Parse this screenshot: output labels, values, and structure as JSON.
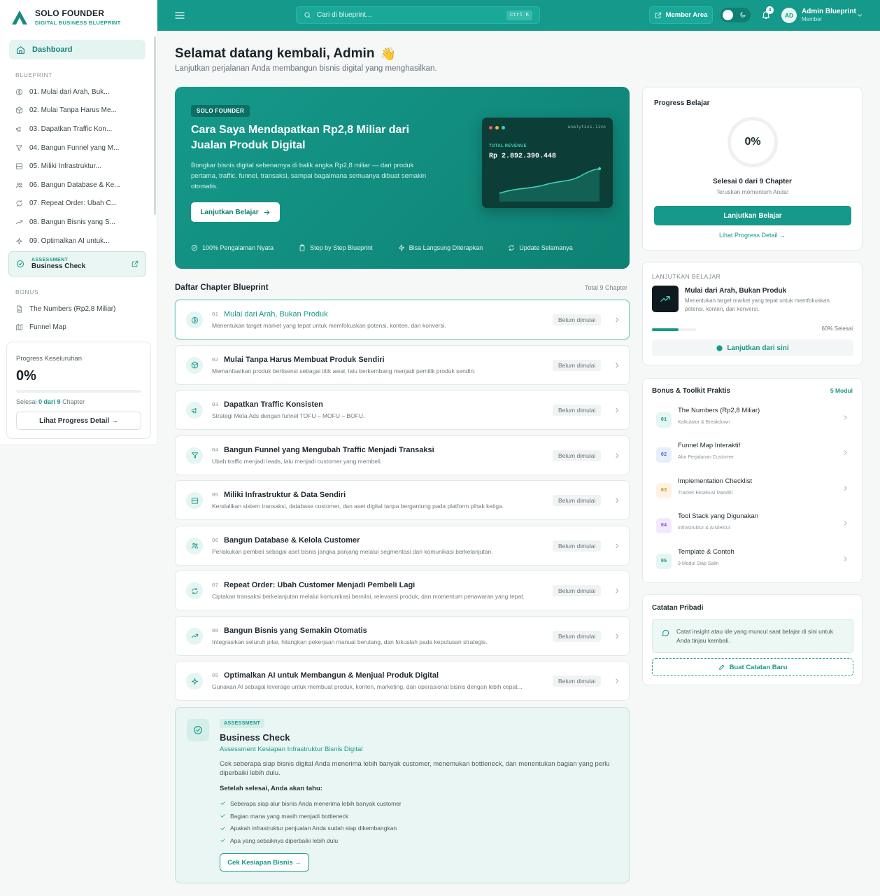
{
  "brand": {
    "name": "SOLO FOUNDER",
    "subtitle": "DIGITAL BUSINESS BLUEPRINT"
  },
  "sidebar": {
    "dashboard_label": "Dashboard",
    "blueprint_label": "BLUEPRINT",
    "items": [
      {
        "label": "01. Mulai dari Arah, Buk...",
        "icon": "dollar-circle-icon"
      },
      {
        "label": "02. Mulai Tanpa Harus Me...",
        "icon": "box-icon"
      },
      {
        "label": "03. Dapatkan Traffic Kon...",
        "icon": "megaphone-icon"
      },
      {
        "label": "04. Bangun Funnel yang M...",
        "icon": "filter-icon"
      },
      {
        "label": "05. Miliki Infrastruktur...",
        "icon": "server-icon"
      },
      {
        "label": "06. Bangun Database & Ke...",
        "icon": "users-icon"
      },
      {
        "label": "07. Repeat Order: Ubah C...",
        "icon": "refresh-icon"
      },
      {
        "label": "08. Bangun Bisnis yang S...",
        "icon": "trending-up-icon"
      },
      {
        "label": "09. Optimalkan AI untuk...",
        "icon": "sparkles-icon"
      }
    ],
    "assessment": {
      "small": "ASSESSMENT",
      "title": "Business Check"
    },
    "bonus_label": "BONUS",
    "bonus_items": [
      {
        "label": "The Numbers (Rp2,8 Miliar)",
        "icon": "document-icon"
      },
      {
        "label": "Funnel Map",
        "icon": "map-icon"
      }
    ],
    "progress": {
      "title": "Progress Keseluruhan",
      "percent": "0%",
      "done_prefix": "Selesai",
      "done_count": "0 dari 9",
      "done_suffix": "Chapter",
      "button": "Lihat Progress Detail →"
    }
  },
  "topbar": {
    "search_placeholder": "Cari di blueprint...",
    "shortcut": "Ctrl K",
    "member_area": "Member Area",
    "notification_count": "4",
    "avatar_initials": "AD",
    "user_name": "Admin Blueprint",
    "user_role": "Member"
  },
  "welcome": {
    "title": "Selamat datang kembali, Admin",
    "emoji": "👋",
    "subtitle": "Lanjutkan perjalanan Anda membangun bisnis digital yang menghasilkan."
  },
  "hero": {
    "badge": "SOLO FOUNDER",
    "title": "Cara Saya Mendapatkan Rp2,8 Miliar dari Jualan Produk Digital",
    "description": "Bongkar bisnis digital sebenarnya di balik angka Rp2,8 miliar — dari produk pertama, traffic, funnel, transaksi, sampai bagaimana semuanya dibuat semakin otomatis.",
    "cta": "Lanjutkan Belajar",
    "features": [
      "100% Pengalaman Nyata",
      "Step by Step Blueprint",
      "Bisa Langsung Diterapkan",
      "Update Selamanya"
    ],
    "analytics": {
      "url": "analytics.live",
      "label": "TOTAL REVENUE",
      "value": "Rp 2.892.390.448"
    }
  },
  "chapters": {
    "title": "Daftar Chapter Blueprint",
    "total": "Total 9 Chapter",
    "items": [
      {
        "num": "01",
        "title": "Mulai dari Arah, Bukan Produk",
        "desc": "Menentukan target market yang tepat untuk memfokuskan potensi, konten, dan konversi.",
        "status": "Belum dimulai"
      },
      {
        "num": "02",
        "title": "Mulai Tanpa Harus Membuat Produk Sendiri",
        "desc": "Memanfaatkan produk berlisensi sebagai titik awal, lalu berkembang menjadi pemilik produk sendiri.",
        "status": "Belum dimulai"
      },
      {
        "num": "03",
        "title": "Dapatkan Traffic Konsisten",
        "desc": "Strategi Meta Ads dengan funnel TOFU – MOFU – BOFU.",
        "status": "Belum dimulai"
      },
      {
        "num": "04",
        "title": "Bangun Funnel yang Mengubah Traffic Menjadi Transaksi",
        "desc": "Ubah traffic menjadi leads, lalu menjadi customer yang membeli.",
        "status": "Belum dimulai"
      },
      {
        "num": "05",
        "title": "Miliki Infrastruktur & Data Sendiri",
        "desc": "Kendalikan sistem transaksi, database customer, dan aset digital tanpa bergantung pada platform pihak ketiga.",
        "status": "Belum dimulai"
      },
      {
        "num": "06",
        "title": "Bangun Database & Kelola Customer",
        "desc": "Perlakukan pembeli sebagai aset bisnis jangka panjang melalui segmentasi dan komunikasi berkelanjutan.",
        "status": "Belum dimulai"
      },
      {
        "num": "07",
        "title": "Repeat Order: Ubah Customer Menjadi Pembeli Lagi",
        "desc": "Ciptakan transaksi berkelanjutan melalui komunikasi bernilai, relevansi produk, dan momentum penawaran yang tepat.",
        "status": "Belum dimulai"
      },
      {
        "num": "08",
        "title": "Bangun Bisnis yang Semakin Otomatis",
        "desc": "Integrasikan seluruh pilar, hilangkan pekerjaan manual berulang, dan fokuslah pada keputusan strategis.",
        "status": "Belum dimulai"
      },
      {
        "num": "09",
        "title": "Optimalkan AI untuk Membangun & Menjual Produk Digital",
        "desc": "Gunakan AI sebagai leverage untuk membuat produk, konten, marketing, dan operasional bisnis dengan lebih cepat...",
        "status": "Belum dimulai"
      }
    ]
  },
  "assessment": {
    "tag": "ASSESSMENT",
    "title": "Business Check",
    "subtitle": "Assessment Kesiapan Infrastruktur Bisnis Digital",
    "description": "Cek seberapa siap bisnis digital Anda menerima lebih banyak customer, menemukan bottleneck, dan menentukan bagian yang perlu diperbaiki lebih dulu.",
    "after_title": "Setelah selesai, Anda akan tahu:",
    "points": [
      "Seberapa siap alur bisnis Anda menerima lebih banyak customer",
      "Bagian mana yang masih menjadi bottleneck",
      "Apakah infrastruktur penjualan Anda sudah siap dikembangkan",
      "Apa yang sebaiknya diperbaiki lebih dulu"
    ],
    "button": "Cek Kesiapan Bisnis →"
  },
  "progress_card": {
    "title": "Progress Belajar",
    "percent": "0%",
    "done": "Selesai 0 dari 9 Chapter",
    "motivation": "Teruskan momentum Anda!",
    "button": "Lanjutkan Belajar",
    "link": "Lihat Progress Detail →"
  },
  "continue_card": {
    "label": "LANJUTKAN BELAJAR",
    "title": "Mulai dari Arah, Bukan Produk",
    "desc": "Menentukan target market yang tepat untuk memfokuskan potensi, konten, dan konversi.",
    "progress": 0.6,
    "progress_text": "60% Selesai",
    "button": "Lanjutkan dari sini"
  },
  "bonus_card": {
    "title": "Bonus & Toolkit Praktis",
    "count": "5 Modul",
    "items": [
      {
        "num": "01",
        "title": "The Numbers (Rp2,8 Miliar)",
        "sub": "Kalkulator & Breakdown",
        "color": "#16998a",
        "bg": "#e5f5f2"
      },
      {
        "num": "02",
        "title": "Funnel Map Interaktif",
        "sub": "Alur Perjalanan Customer",
        "color": "#3b6fd8",
        "bg": "#e8effc"
      },
      {
        "num": "03",
        "title": "Implementation Checklist",
        "sub": "Tracker Eksekusi Mandiri",
        "color": "#d98a1a",
        "bg": "#fdf3e3"
      },
      {
        "num": "04",
        "title": "Tool Stack yang Digunakan",
        "sub": "Infrastruktur & Arsitektur",
        "color": "#8b4fd6",
        "bg": "#f2eafc"
      },
      {
        "num": "05",
        "title": "Template & Contoh",
        "sub": "9 Modul Siap Salin",
        "color": "#16998a",
        "bg": "#e5f5f2"
      }
    ]
  },
  "notes_card": {
    "title": "Catatan Pribadi",
    "note": "Catat insight atau ide yang muncul saat belajar di sini untuk Anda tinjau kembali.",
    "button": "Buat Catatan Baru"
  }
}
